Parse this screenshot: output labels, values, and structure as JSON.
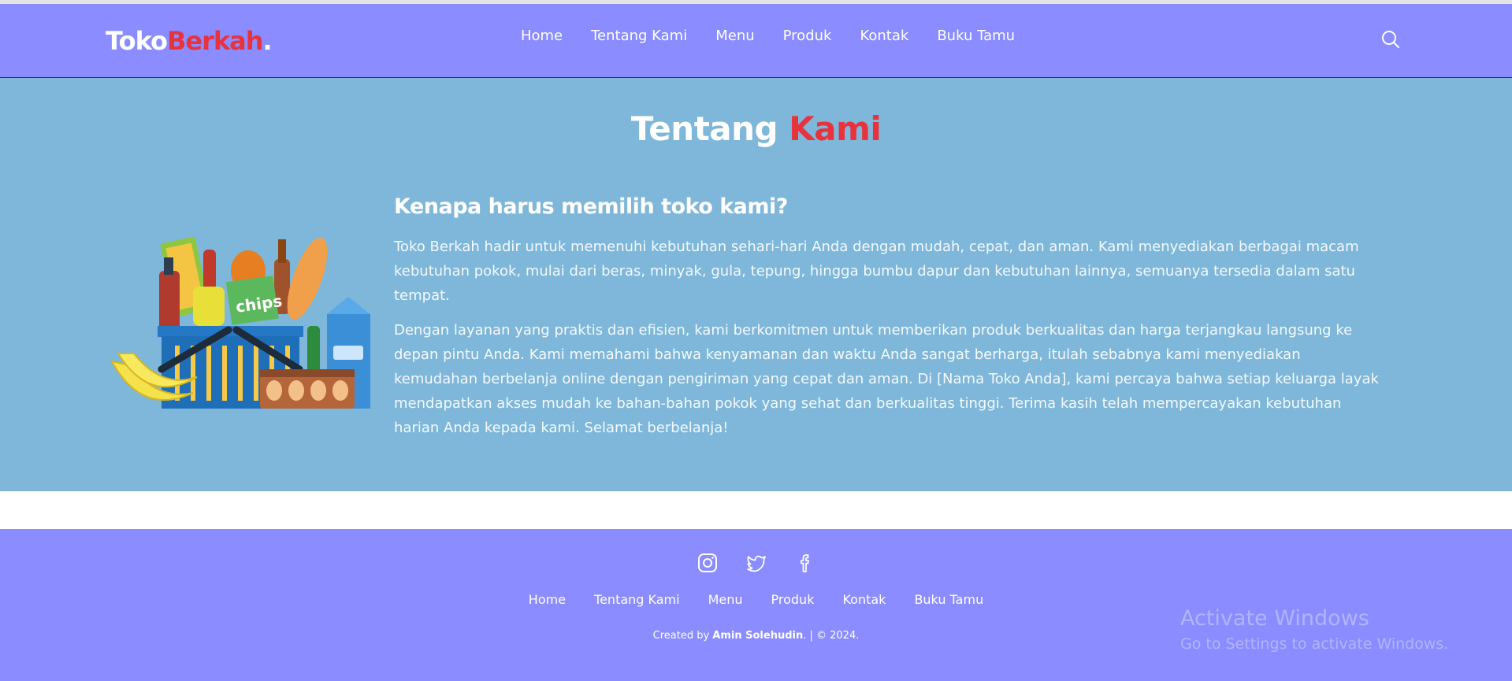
{
  "header": {
    "logo_part1": "Toko",
    "logo_part2": "Berkah",
    "logo_dot": ".",
    "nav": [
      "Home",
      "Tentang Kami",
      "Menu",
      "Produk",
      "Kontak",
      "Buku Tamu"
    ],
    "search_icon": "search-icon"
  },
  "about": {
    "title_part1": "Tentang",
    "title_part2": "Kami",
    "heading": "Kenapa harus memilih toko kami?",
    "paragraph1": "Toko Berkah hadir untuk memenuhi kebutuhan sehari-hari Anda dengan mudah, cepat, dan aman. Kami menyediakan berbagai macam kebutuhan pokok, mulai dari beras, minyak, gula, tepung, hingga bumbu dapur dan kebutuhan lainnya, semuanya tersedia dalam satu tempat.",
    "paragraph2": "Dengan layanan yang praktis dan efisien, kami berkomitmen untuk memberikan produk berkualitas dan harga terjangkau langsung ke depan pintu Anda. Kami memahami bahwa kenyamanan dan waktu Anda sangat berharga, itulah sebabnya kami menyediakan kemudahan berbelanja online dengan pengiriman yang cepat dan aman. Di [Nama Toko Anda], kami percaya bahwa setiap keluarga layak mendapatkan akses mudah ke bahan-bahan pokok yang sehat dan berkualitas tinggi. Terima kasih telah mempercayakan kebutuhan harian Anda kepada kami. Selamat berbelanja!",
    "illustration_text": "chips"
  },
  "footer": {
    "socials": [
      "instagram-icon",
      "twitter-icon",
      "facebook-icon"
    ],
    "links": [
      "Home",
      "Tentang Kami",
      "Menu",
      "Produk",
      "Kontak",
      "Buku Tamu"
    ],
    "credit_prefix": "Created by",
    "credit_name": "Amin Solehudin",
    "credit_suffix": ". | © 2024."
  },
  "watermark": {
    "line1": "Activate Windows",
    "line2": "Go to Settings to activate Windows."
  },
  "colors": {
    "navbar": "#8a8cff",
    "about_bg": "#7eb7da",
    "accent_red": "#e8323c",
    "text": "#ffffff"
  }
}
